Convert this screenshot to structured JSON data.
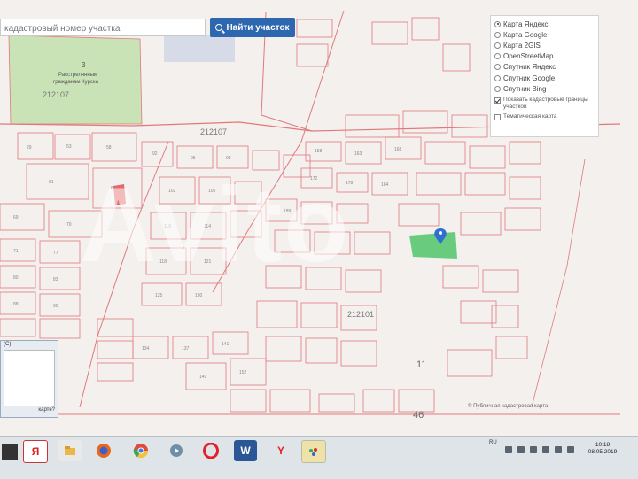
{
  "search": {
    "placeholder": "кадастровый номер участка",
    "button_label": "Найти участок"
  },
  "map_labels": {
    "quarter_1": "212107",
    "quarter_2": "212107",
    "quarter_3": "212101",
    "district_number": "3",
    "district_name_1": "Расстрелянным",
    "district_name_2": "гражданам Курска",
    "big_number_11": "11",
    "big_number_46": "46",
    "parcel_labels": [
      "29",
      "53",
      "58",
      "61",
      "64",
      "69",
      "70",
      "71",
      "77",
      "80",
      "83",
      "88",
      "90",
      "92",
      "95",
      "98",
      "102",
      "105",
      "110",
      "114",
      "118",
      "121",
      "125",
      "130",
      "134",
      "137",
      "141",
      "149",
      "152",
      "158",
      "163",
      "168",
      "172",
      "178",
      "184",
      "189"
    ]
  },
  "layers": {
    "options": [
      {
        "label": "Карта Яндекс",
        "selected": true
      },
      {
        "label": "Карта Google",
        "selected": false
      },
      {
        "label": "Карта 2GIS",
        "selected": false
      },
      {
        "label": "OpenStreetMap",
        "selected": false
      },
      {
        "label": "Спутник Яндекс",
        "selected": false
      },
      {
        "label": "Спутник Google",
        "selected": false
      },
      {
        "label": "Спутник Bing",
        "selected": false
      }
    ],
    "show_cadastral_label": "Показать кадастровые границы участков",
    "show_cadastral_checked": true,
    "thematic_label": "Тематическая карта",
    "thematic_checked": false
  },
  "attribution": "© Публичная кадастровая карта",
  "popup": {
    "title": "(C)",
    "footer_text": "карте?"
  },
  "watermark": "Avito",
  "taskbar": {
    "yandex_label": "Я",
    "word_label": "W",
    "y_label": "Y",
    "lang": "RU",
    "time": "10:18",
    "date": "08.05.2019"
  },
  "colors": {
    "parcel_border": "#e07a7a",
    "park_fill": "#c9e2b6",
    "selected_parcel": "#4fc46a",
    "marker": "#2f6fd1",
    "search_button": "#2c67b0"
  }
}
